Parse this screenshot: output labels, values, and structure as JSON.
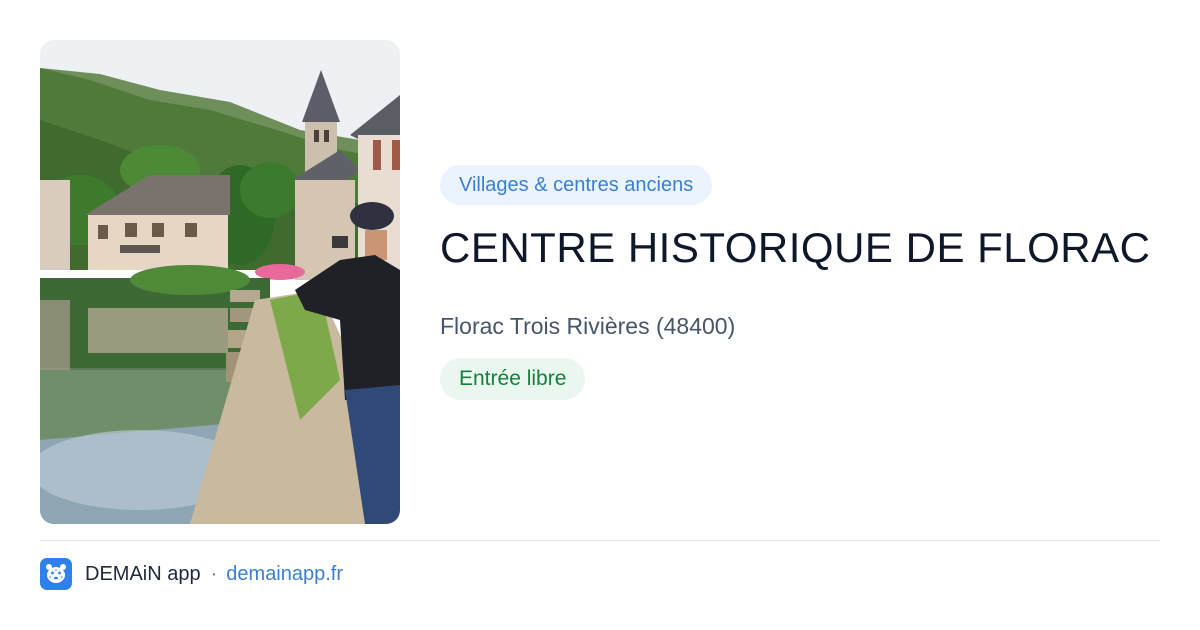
{
  "card": {
    "category": "Villages & centres anciens",
    "title": "CENTRE HISTORIQUE DE FLORAC",
    "location": "Florac Trois Rivières (48400)",
    "entry": "Entrée libre"
  },
  "footer": {
    "app_name": "DEMAiN app",
    "separator": "·",
    "site": "demainapp.fr"
  },
  "colors": {
    "category_chip_bg": "#eaf3fe",
    "category_chip_text": "#3b7fd4",
    "entry_chip_bg": "#eaf7ee",
    "entry_chip_text": "#15803d",
    "link": "#3b7fd4",
    "app_icon": "#2f80ed"
  },
  "icons": {
    "app": "leopard-face-icon"
  }
}
